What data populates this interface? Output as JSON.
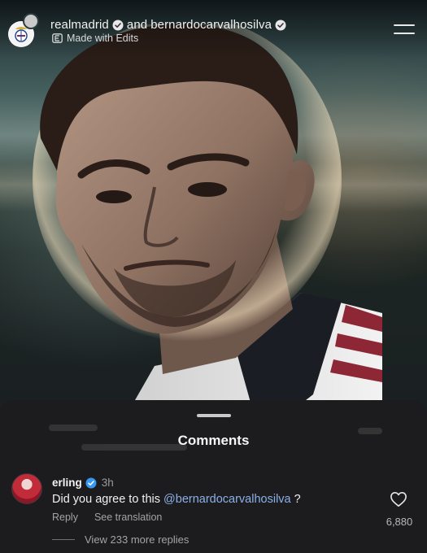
{
  "header": {
    "account_primary": "realmadrid",
    "joiner": "and",
    "account_collab": "bernardocarvalhosilva",
    "subtitle": "Made with Edits",
    "icons": {
      "avatar": "real-madrid-crest-icon",
      "verified": "verified-badge-icon",
      "edits": "edits-app-icon",
      "menu": "menu-icon"
    }
  },
  "comments_sheet": {
    "title": "Comments",
    "comment": {
      "username": "erling",
      "time": "3h",
      "text_prefix": "Did you agree to this ",
      "mention": "@bernardocarvalhosilva",
      "text_suffix": " ?",
      "reply_label": "Reply",
      "translate_label": "See translation",
      "likes": "6,880",
      "view_replies": "View 233 more replies"
    }
  },
  "colors": {
    "sheet_bg": "#1c1c1e",
    "mention": "#8bb1e8",
    "verified": "#3897f0"
  }
}
